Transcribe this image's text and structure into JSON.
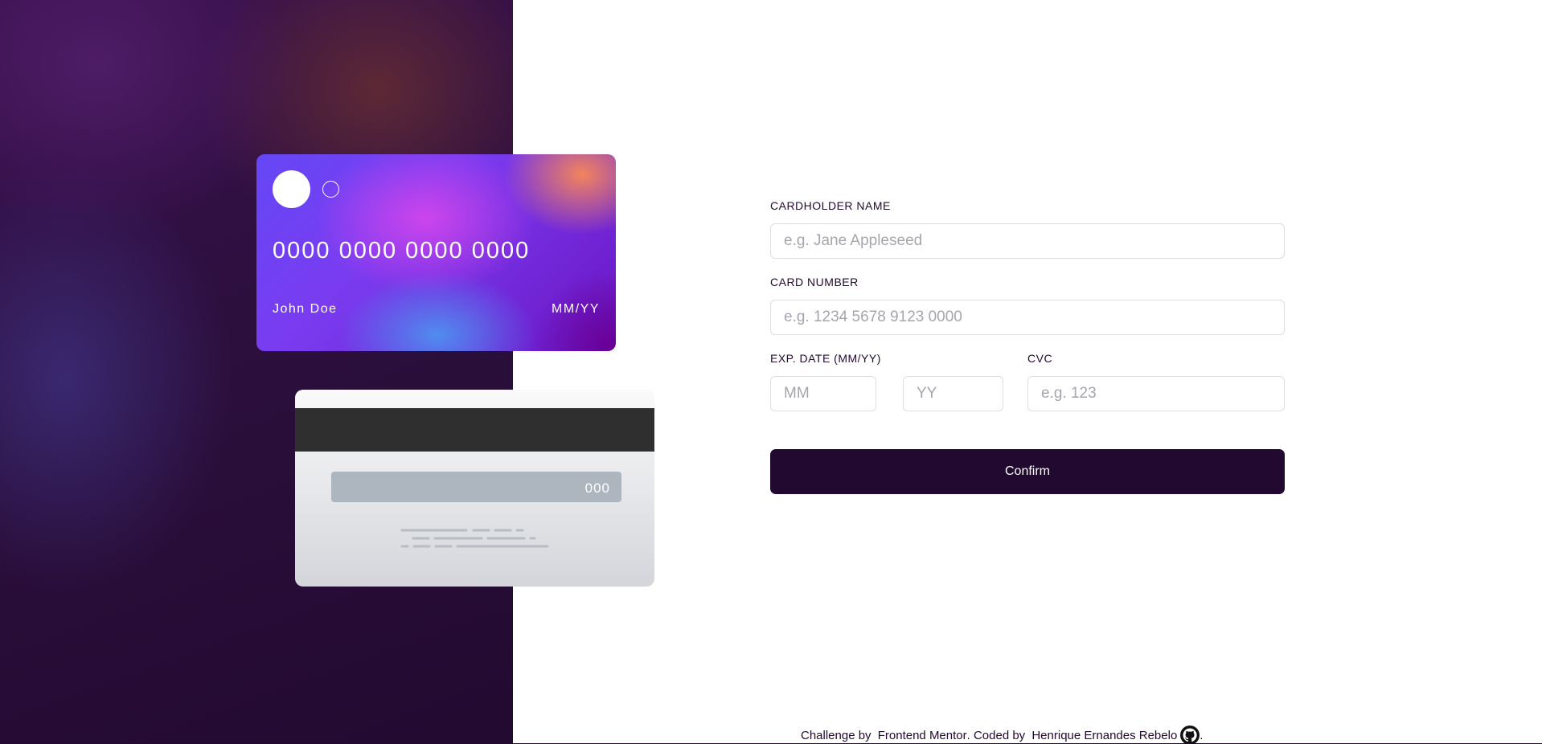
{
  "card_front": {
    "number": "0000 0000 0000 0000",
    "name": "John Doe",
    "expiry": "MM/YY"
  },
  "card_back": {
    "cvc": "000"
  },
  "form": {
    "cardholder_label": "CARDHOLDER NAME",
    "cardholder_placeholder": "e.g. Jane Appleseed",
    "number_label": "CARD NUMBER",
    "number_placeholder": "e.g. 1234 5678 9123 0000",
    "exp_label": "EXP. DATE (MM/YY)",
    "month_placeholder": "MM",
    "year_placeholder": "YY",
    "cvc_label": "CVC",
    "cvc_placeholder": "e.g. 123",
    "confirm_label": "Confirm"
  },
  "footer": {
    "prefix": "Challenge by ",
    "challenge_link": "Frontend Mentor",
    "middle": ". Coded by ",
    "author_link": "Henrique Ernandes Rebelo",
    "suffix": ".",
    "icon": "github-icon"
  },
  "colors": {
    "dark_violet": "#21092f",
    "input_border": "#dedddf",
    "placeholder": "#a8a4ad"
  }
}
